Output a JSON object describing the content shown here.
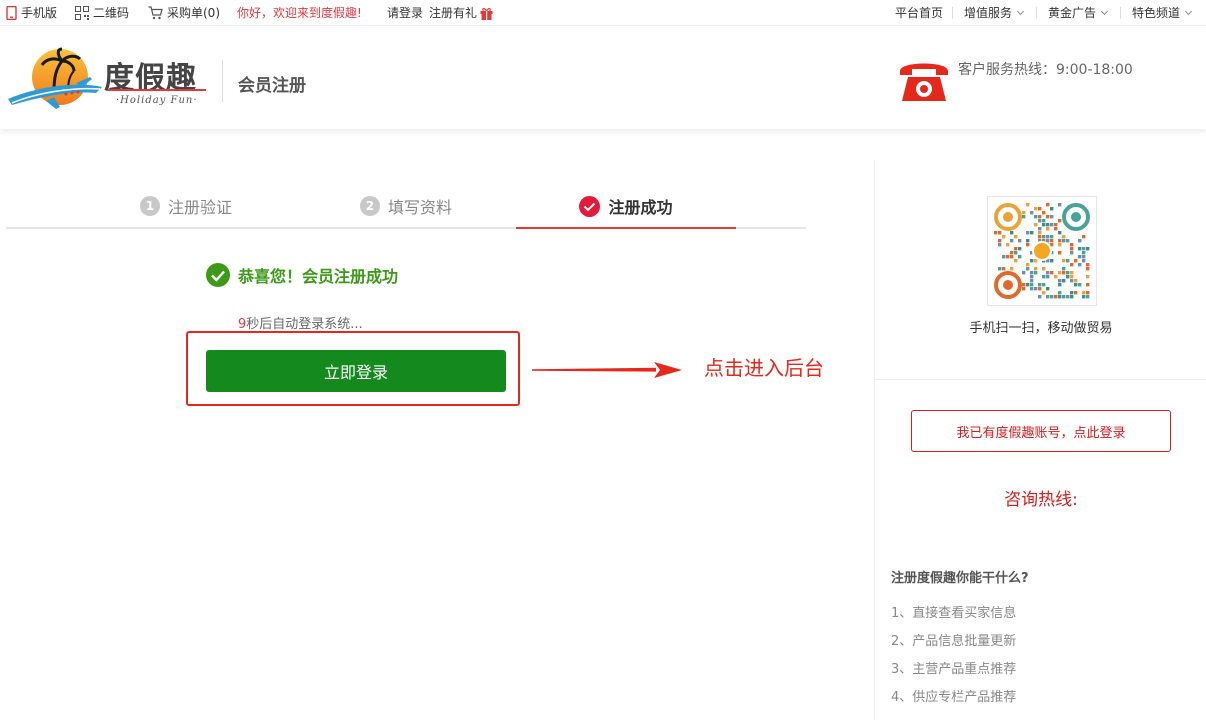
{
  "topbar": {
    "mobile": "手机版",
    "qrcode": "二维码",
    "cart": "采购单(0)",
    "welcome": "你好，欢迎来到度假趣!",
    "login": "请登录",
    "register_gift": "注册有礼",
    "nav": [
      "平台首页",
      "增值服务",
      "黄金广告",
      "特色频道"
    ]
  },
  "header": {
    "logo_text": "度假趣",
    "logo_sub": "·Holiday Fun·",
    "title": "会员注册",
    "hotline": "客户服务热线：9:00-18:00"
  },
  "steps": [
    {
      "num": "1",
      "label": "注册验证"
    },
    {
      "num": "2",
      "label": "填写资料"
    },
    {
      "num": "",
      "label": "注册成功"
    }
  ],
  "success": {
    "message": "恭喜您！会员注册成功",
    "countdown_num": "9",
    "countdown_text": "秒后自动登录系统...",
    "login_button": "立即登录",
    "annotation": "点击进入后台"
  },
  "sidebar": {
    "qr_caption": "手机扫一扫，移动做贸易",
    "has_account_button": "我已有度假趣账号，点此登录",
    "consult_hotline": "咨询热线:",
    "benefits_title": "注册度假趣你能干什么?",
    "benefits": [
      "1、直接查看买家信息",
      "2、产品信息批量更新",
      "3、主营产品重点推荐",
      "4、供应专栏产品推荐"
    ]
  },
  "colors": {
    "brand_red": "#e4393c",
    "success_green": "#3c9a18",
    "button_green": "#148a1e",
    "annotation_red": "#e4281c"
  }
}
